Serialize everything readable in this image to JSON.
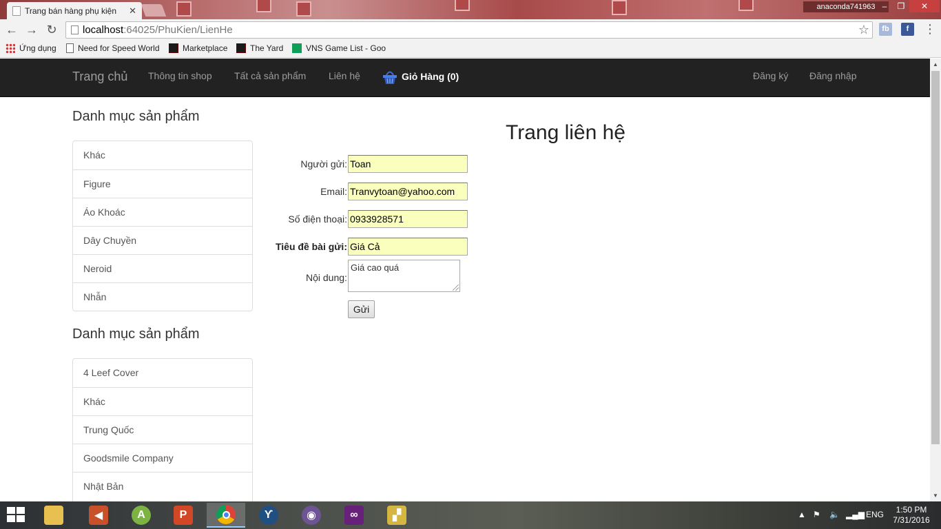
{
  "browser": {
    "tab_title": "Trang bán hàng phụ kiện",
    "user_name": "anaconda741963",
    "url_host": "localhost",
    "url_rest": ":64025/PhuKien/LienHe",
    "bookmarks": [
      {
        "label": "Ứng dụng",
        "icon": "apps-grid-icon"
      },
      {
        "label": "Need for Speed World",
        "icon": "page-icon"
      },
      {
        "label": "Marketplace",
        "icon": "game-icon"
      },
      {
        "label": "The Yard",
        "icon": "game-icon"
      },
      {
        "label": "VNS Game List - Goog",
        "icon": "sheets-icon"
      }
    ],
    "extensions": [
      {
        "label": "fb",
        "icon": "fb-icon"
      },
      {
        "label": "f",
        "icon": "facebook-icon"
      }
    ]
  },
  "navbar": {
    "brand": "Trang chủ",
    "links": [
      "Thông tin shop",
      "Tất cả sản phẩm",
      "Liên hệ"
    ],
    "cart_label": "Giỏ Hàng (0)",
    "register": "Đăng ký",
    "login": "Đăng nhập"
  },
  "sidebar": {
    "sections": [
      {
        "heading": "Danh mục sản phẩm",
        "items": [
          "Khác",
          "Figure",
          "Áo Khoác",
          "Dây Chuyền",
          "Neroid",
          "Nhẫn"
        ]
      },
      {
        "heading": "Danh mục sản phẩm",
        "items": [
          "4 Leef Cover",
          "Khác",
          "Trung Quốc",
          "Goodsmile Company",
          "Nhật Bản"
        ]
      }
    ]
  },
  "contact": {
    "title": "Trang liên hệ",
    "fields": [
      {
        "label": "Người gửi:",
        "value": "Toan"
      },
      {
        "label": "Email:",
        "value": "Tranvytoan@yahoo.com"
      },
      {
        "label": "Số điện thoại:",
        "value": "0933928571"
      },
      {
        "label": "Tiêu đề bài gửi:",
        "value": "Giá Cả"
      }
    ],
    "content_label": "Nội dung:",
    "content_value": "Giá cao quá",
    "submit": "Gửi"
  },
  "taskbar": {
    "apps": [
      "file-explorer-icon",
      "volume-app-icon",
      "android-studio-icon",
      "powerpoint-icon",
      "chrome-icon",
      "sourcetree-icon",
      "github-icon",
      "visual-studio-icon",
      "sticky-app-icon"
    ],
    "language": "ENG",
    "time": "1:50 PM",
    "date": "7/31/2016"
  }
}
